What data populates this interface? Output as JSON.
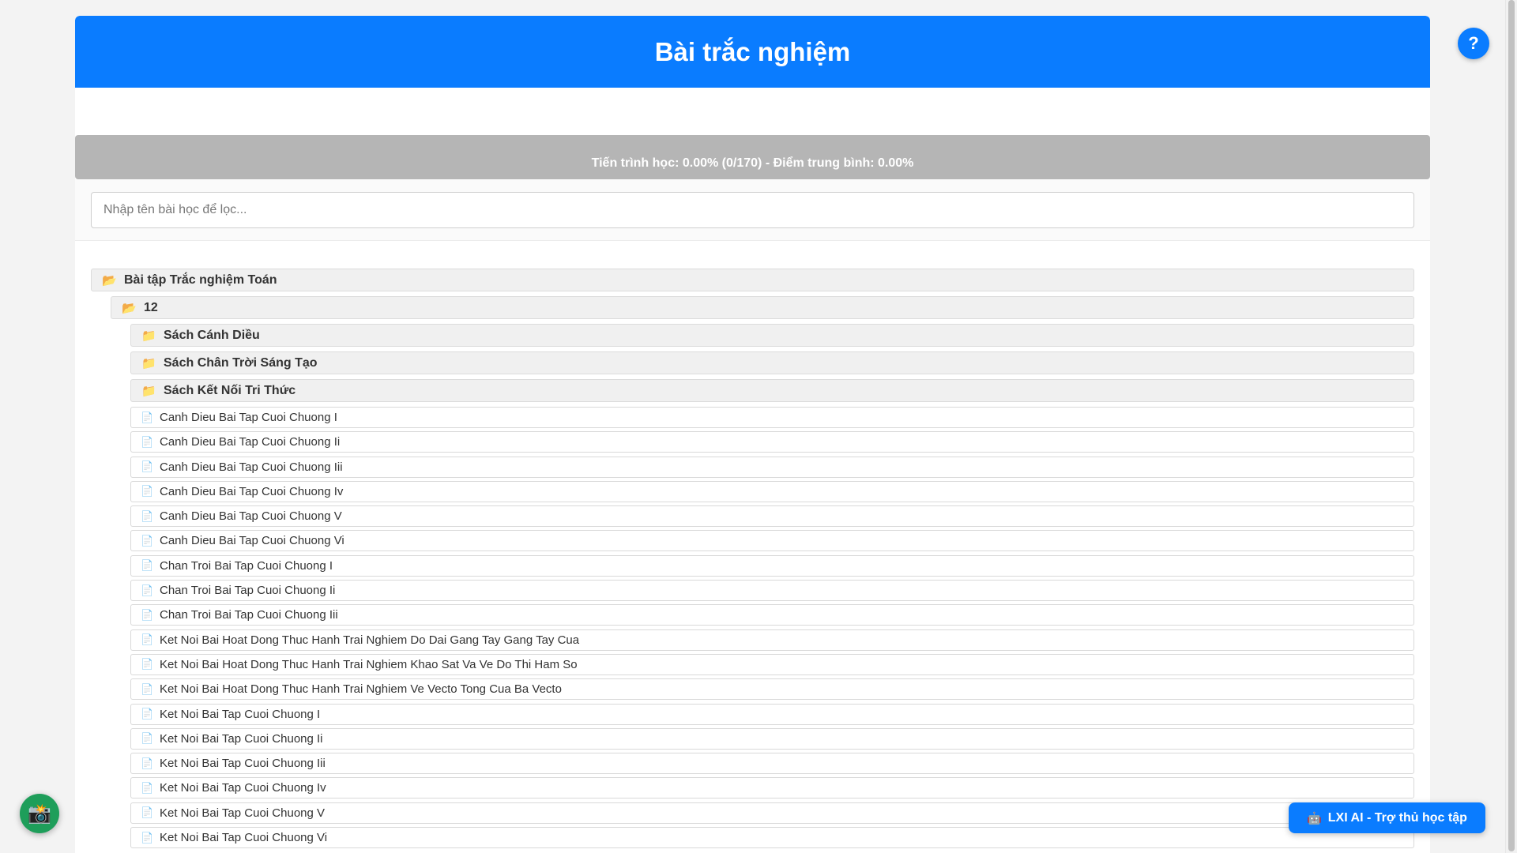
{
  "header": {
    "title": "Bài trắc nghiệm"
  },
  "progress": {
    "text": "Tiến trình học: 0.00% (0/170) - Điểm trung bình: 0.00%",
    "completed_fraction": 0.0
  },
  "search": {
    "placeholder": "Nhập tên bài học để lọc...",
    "value": ""
  },
  "tree": {
    "root": {
      "label": "Bài tập Trắc nghiệm Toán",
      "icon": "open-folder-icon"
    },
    "grade": {
      "label": "12",
      "icon": "open-folder-icon"
    },
    "books": [
      {
        "label": "Sách Cánh Diều",
        "icon": "folder-icon"
      },
      {
        "label": "Sách Chân Trời Sáng Tạo",
        "icon": "folder-icon"
      },
      {
        "label": "Sách Kết Nối Tri Thức",
        "icon": "folder-icon"
      }
    ],
    "lessons": [
      "Canh Dieu Bai Tap Cuoi Chuong I",
      "Canh Dieu Bai Tap Cuoi Chuong Ii",
      "Canh Dieu Bai Tap Cuoi Chuong Iii",
      "Canh Dieu Bai Tap Cuoi Chuong Iv",
      "Canh Dieu Bai Tap Cuoi Chuong V",
      "Canh Dieu Bai Tap Cuoi Chuong Vi",
      "Chan Troi Bai Tap Cuoi Chuong I",
      "Chan Troi Bai Tap Cuoi Chuong Ii",
      "Chan Troi Bai Tap Cuoi Chuong Iii",
      "Ket Noi Bai Hoat Dong Thuc Hanh Trai Nghiem Do Dai Gang Tay Gang Tay Cua",
      "Ket Noi Bai Hoat Dong Thuc Hanh Trai Nghiem Khao Sat Va Ve Do Thi Ham So",
      "Ket Noi Bai Hoat Dong Thuc Hanh Trai Nghiem Ve Vecto Tong Cua Ba Vecto",
      "Ket Noi Bai Tap Cuoi Chuong I",
      "Ket Noi Bai Tap Cuoi Chuong Ii",
      "Ket Noi Bai Tap Cuoi Chuong Iii",
      "Ket Noi Bai Tap Cuoi Chuong Iv",
      "Ket Noi Bai Tap Cuoi Chuong V",
      "Ket Noi Bai Tap Cuoi Chuong Vi"
    ]
  },
  "floating": {
    "help_label": "?",
    "camera_icon": "camera-icon",
    "ai_label": "LXI AI - Trợ thủ học tập",
    "ai_icon": "robot-icon"
  },
  "colors": {
    "accent": "#0a7cff",
    "progress_track": "#b5b5b5",
    "camera_button": "#1e9e5a"
  }
}
